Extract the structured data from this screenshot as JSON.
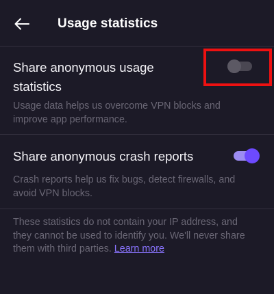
{
  "header": {
    "title": "Usage statistics",
    "back_icon": "arrow-left-icon"
  },
  "settings": [
    {
      "title_line1": "Share anonymous usage",
      "title_line2": "statistics",
      "description": "Usage data helps us overcome VPN blocks and improve app performance.",
      "enabled": false
    },
    {
      "title": "Share anonymous crash reports",
      "description": "Crash reports help us fix bugs, detect firewalls, and avoid VPN blocks.",
      "enabled": true
    }
  ],
  "footer": {
    "note": "These statistics do not contain your IP address, and they cannot be used to identify you. We'll never share them with third parties. ",
    "link_text": "Learn more"
  },
  "colors": {
    "background": "#1c1a27",
    "accent": "#6d4aff",
    "highlight": "#ee1111"
  }
}
